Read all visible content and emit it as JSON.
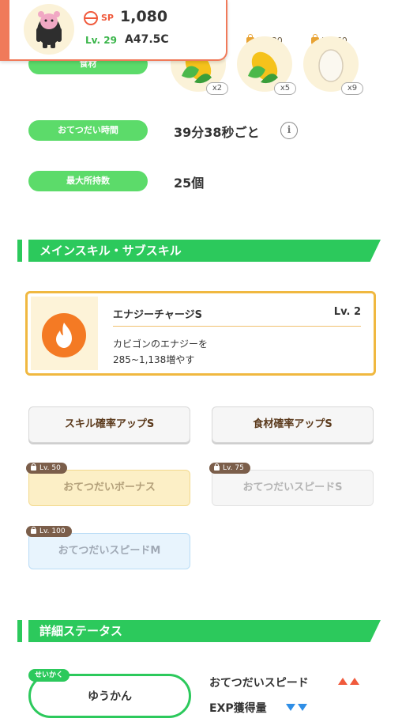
{
  "summary": {
    "sp_label": "SP",
    "sp_value": "1,080",
    "level": "Lv. 29",
    "code": "A47.5C",
    "accent_color": "#f07a5a"
  },
  "ingredients": {
    "label": "食材",
    "items": [
      {
        "name": "corn",
        "qty": "x2",
        "lv": ""
      },
      {
        "name": "corn",
        "qty": "x5",
        "lv": "Lv. 30"
      },
      {
        "name": "egg",
        "qty": "x9",
        "lv": "Lv. 60"
      }
    ]
  },
  "help_time": {
    "label": "おてつだい時間",
    "value": "39分38秒ごと",
    "info_icon": "info-icon"
  },
  "max_carry": {
    "label": "最大所持数",
    "value": "25個"
  },
  "main_skill_section": {
    "title": "メインスキル・サブスキル"
  },
  "main_skill": {
    "name": "エナジーチャージS",
    "level": "Lv. 2",
    "desc_line1": "カビゴンのエナジーを",
    "desc_line2": "285~1,138増やす",
    "icon": "fire-icon"
  },
  "sub_skills": [
    {
      "label": "スキル確率アップS",
      "lock": ""
    },
    {
      "label": "食材確率アップS",
      "lock": ""
    },
    {
      "label": "おてつだいボーナス",
      "lock": "Lv. 50"
    },
    {
      "label": "おてつだいスピードS",
      "lock": "Lv. 75"
    },
    {
      "label": "おてつだいスピードM",
      "lock": "Lv. 100"
    }
  ],
  "details_section": {
    "title": "詳細ステータス"
  },
  "nature": {
    "tag": "せいかく",
    "value": "ゆうかん",
    "stats": [
      {
        "label": "おてつだいスピード",
        "direction": "up",
        "color": "#f05a3c"
      },
      {
        "label": "EXP獲得量",
        "direction": "down",
        "color": "#2f8ee6"
      }
    ]
  },
  "colors": {
    "green": "#2cc95c",
    "pill_green": "#5cdb6a",
    "gold": "#f0b840"
  }
}
